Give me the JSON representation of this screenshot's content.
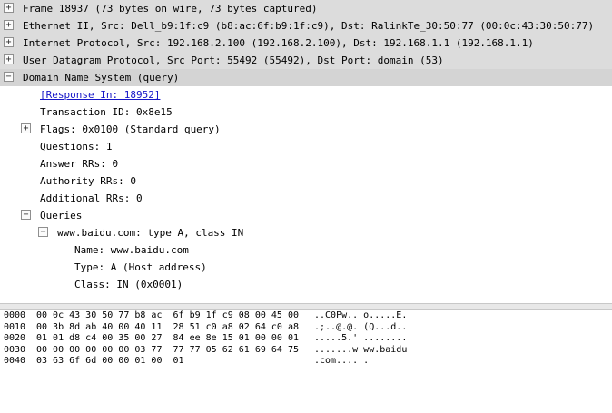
{
  "tree": {
    "frame": "Frame 18937 (73 bytes on wire, 73 bytes captured)",
    "ethernet": "Ethernet II, Src: Dell_b9:1f:c9 (b8:ac:6f:b9:1f:c9), Dst: RalinkTe_30:50:77 (00:0c:43:30:50:77)",
    "ip": "Internet Protocol, Src: 192.168.2.100 (192.168.2.100), Dst: 192.168.1.1 (192.168.1.1)",
    "udp": "User Datagram Protocol, Src Port: 55492 (55492), Dst Port: domain (53)",
    "dns": "Domain Name System (query)",
    "response_in": "[Response In: 18952]",
    "transaction_id": "Transaction ID: 0x8e15",
    "flags": "Flags: 0x0100 (Standard query)",
    "questions": "Questions: 1",
    "answer_rrs": "Answer RRs: 0",
    "authority_rrs": "Authority RRs: 0",
    "additional_rrs": "Additional RRs: 0",
    "queries": "Queries",
    "query": "www.baidu.com: type A, class IN",
    "name": "Name: www.baidu.com",
    "type": "Type: A (Host address)",
    "class": "Class: IN (0x0001)",
    "expand_symbol": "+",
    "collapse_symbol": "−"
  },
  "hex": [
    {
      "offset": "0000",
      "bytes": "00 0c 43 30 50 77 b8 ac  6f b9 1f c9 08 00 45 00",
      "ascii": "..C0Pw.. o.....E."
    },
    {
      "offset": "0010",
      "bytes": "00 3b 8d ab 40 00 40 11  28 51 c0 a8 02 64 c0 a8",
      "ascii": ".;..@.@. (Q...d.."
    },
    {
      "offset": "0020",
      "bytes": "01 01 d8 c4 00 35 00 27  84 ee 8e 15 01 00 00 01",
      "ascii": ".....5.' ........"
    },
    {
      "offset": "0030",
      "bytes": "00 00 00 00 00 00 03 77  77 77 05 62 61 69 64 75",
      "ascii": ".......w ww.baidu"
    },
    {
      "offset": "0040",
      "bytes": "03 63 6f 6d 00 00 01 00  01",
      "ascii": ".com.... ."
    }
  ]
}
